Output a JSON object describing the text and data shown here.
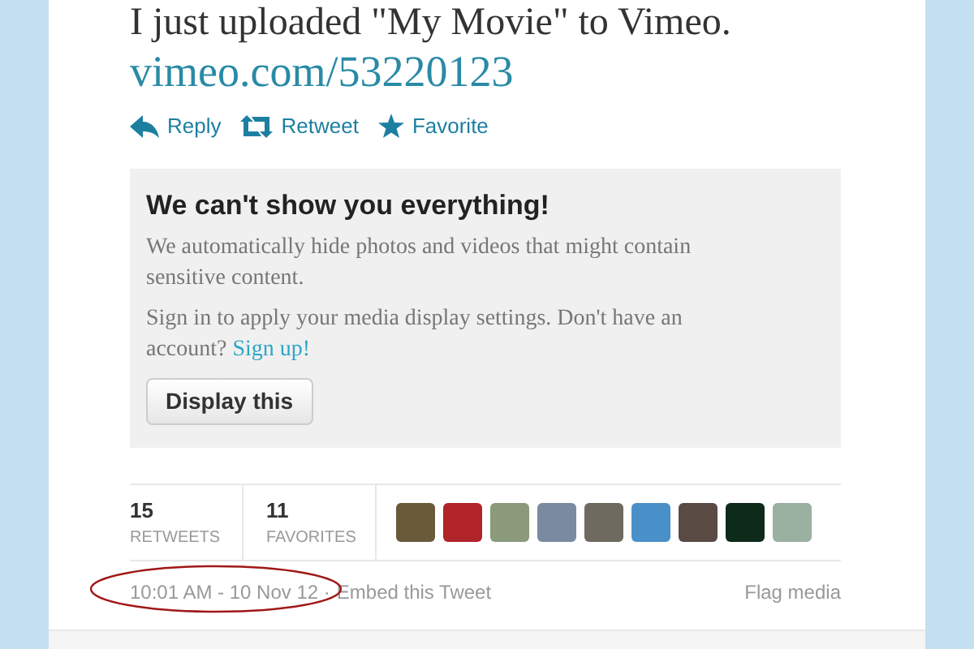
{
  "tweet": {
    "text": "I just uploaded \"My Movie\" to Vimeo.",
    "link": "vimeo.com/53220123"
  },
  "actions": [
    "Reply",
    "Retweet",
    "Favorite"
  ],
  "notice": {
    "title": "We can't show you everything!",
    "body": "We automatically hide photos and videos that might contain sensitive content.",
    "signin": "Sign in to apply your media display settings. Don't have an account?",
    "signup": "Sign up!",
    "button": "Display this"
  },
  "stats": [
    {
      "count": "15",
      "label": "RETWEETS"
    },
    {
      "count": "11",
      "label": "FAVORITES"
    }
  ],
  "footer": {
    "time": "10:01 AM - 10 Nov 12 ·",
    "embed": "Embed this Tweet",
    "flag": "Flag media"
  }
}
